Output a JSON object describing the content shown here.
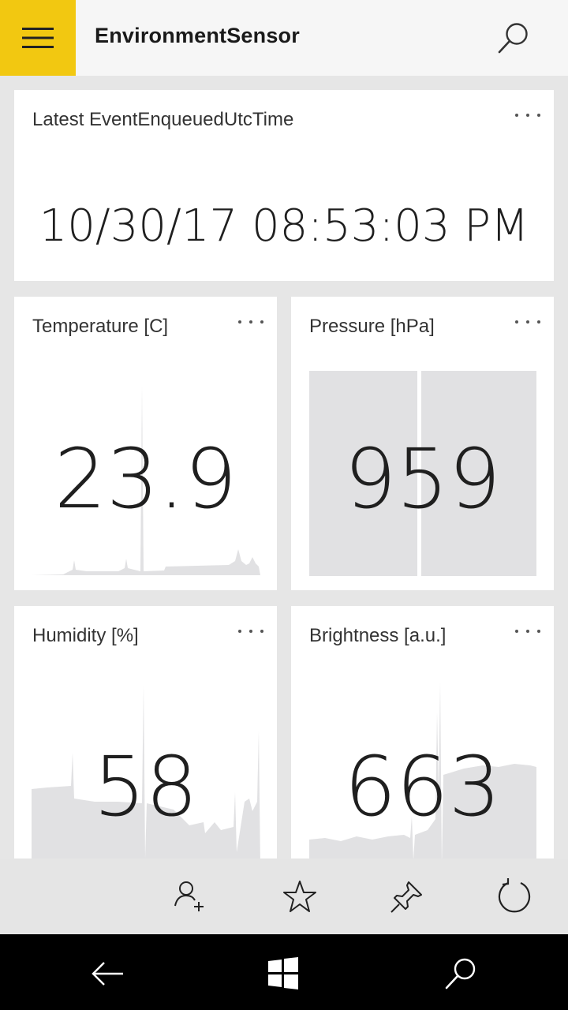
{
  "header": {
    "title": "EnvironmentSensor"
  },
  "tiles": {
    "latest": {
      "title": "Latest EventEnqueuedUtcTime",
      "value": "10/30/17 08:53:03 PM"
    },
    "temperature": {
      "title": "Temperature [C]",
      "value": "23.9"
    },
    "pressure": {
      "title": "Pressure [hPa]",
      "value": "959"
    },
    "humidity": {
      "title": "Humidity [%]",
      "value": "58"
    },
    "brightness": {
      "title": "Brightness [a.u.]",
      "value": "663"
    }
  },
  "appbar": {
    "icons": [
      "add-user-icon",
      "star-icon",
      "pin-icon",
      "refresh-icon"
    ]
  },
  "navbar": {
    "icons": [
      "back-arrow-icon",
      "windows-logo-icon",
      "search-icon"
    ]
  },
  "colors": {
    "accent": "#f2c811",
    "sparkline": "#e1e1e3",
    "page": "#e6e6e6"
  }
}
